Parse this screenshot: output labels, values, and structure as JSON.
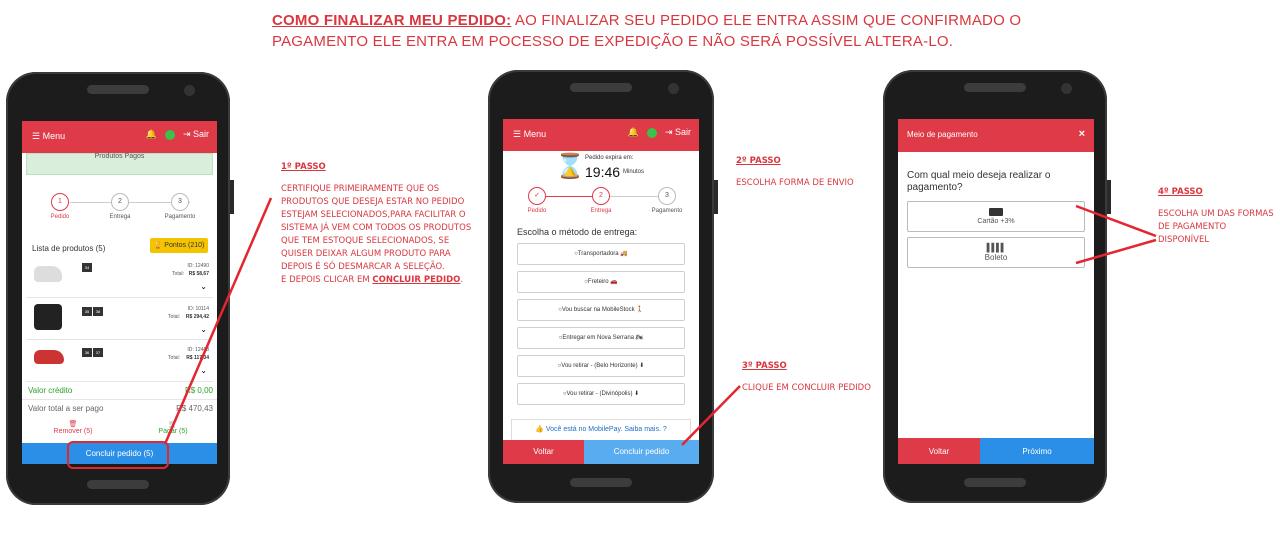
{
  "title": {
    "lead": "COMO FINALIZAR MEU PEDIDO:",
    "rest": " AO FINALIZAR SEU PEDIDO ELE ENTRA ASSIM QUE CONFIRMADO O PAGAMENTO ELE ENTRA EM POCESSO DE EXPEDIÇÃO E NÃO SERÁ POSSÍVEL ALTERA-LO."
  },
  "notes": {
    "step1_title": "1º PASSO",
    "step1_body": "CERTIFIQUE PRIMEIRAMENTE QUE OS PRODUTOS QUE DESEJA ESTAR NO PEDIDO ESTEJAM SELECIONADOS,PARA FACILITAR O SISTEMA JÁ VEM COM TODOS OS PRODUTOS QUE TEM ESTOQUE SELECIONADOS, SE QUISER DEIXAR ALGUM PRODUTO PARA DEPOIS É SÓ DESMARCAR A SELEÇÃO.",
    "step1_tail": "E DEPOIS CLICAR EM ",
    "step1_link": "CONCLUIR PEDIDO",
    "step2_title": "2º PASSO",
    "step2_body": "ESCOLHA FORMA DE ENVIO",
    "step3_title": "3º PASSO",
    "step3_body": "CLIQUE EM CONCLUIR PEDIDO",
    "step4_title": "4º PASSO",
    "step4_body": "ESCOLHA UM DAS FORMAS DE PAGAMENTO DISPONÍVEL"
  },
  "appbar": {
    "menu": "Menu",
    "logout": "Sair"
  },
  "steps": [
    "Pedido",
    "Entrega",
    "Pagamento"
  ],
  "phone1": {
    "banner": "Produtos Pagos",
    "list_title": "Lista de produtos (5)",
    "points": "Pontos (210)",
    "products": [
      {
        "sizes": [
          "34"
        ],
        "id": "ID: 12490",
        "total_label": "Total:",
        "total": "R$ 58,67"
      },
      {
        "sizes": [
          "35",
          "38"
        ],
        "id": "ID: 10114",
        "total_label": "Total:",
        "total": "R$ 294,42"
      },
      {
        "sizes": [
          "36",
          "37"
        ],
        "id": "ID: 12488",
        "total_label": "Total:",
        "total": "R$ 117,34"
      }
    ],
    "credit_label": "Valor crédito",
    "credit_value": "R$ 0,00",
    "total_label": "Valor total a ser pago",
    "total_value": "R$ 470,43",
    "remove": "Remover (5)",
    "pay": "Pagar (5)",
    "conclude": "Concluir pedido (5)"
  },
  "phone2": {
    "expires_label": "Pedido expira em:",
    "timer": "19:46",
    "timer_unit": "Minutos",
    "heading": "Escolha o método de entrega:",
    "options": [
      "Transportadora 🚚",
      "Freteiro 🚗",
      "Vou buscar na MobileStock 🚶",
      "Entregar em Nova Serrana 🏍",
      "Vou retirar - (Belo Horizonte) ⬇",
      "Vou retirar - (Divinópolis) ⬇"
    ],
    "mobilepay": "Você está no MobilePay. Saiba mais.",
    "back": "Voltar",
    "conclude": "Concluir pedido"
  },
  "phone3": {
    "header": "Meio de pagamento",
    "question": "Com qual meio deseja realizar o pagamento?",
    "card": "Cartão +3%",
    "boleto": "Boleto",
    "back": "Voltar",
    "next": "Próximo"
  },
  "colors": {
    "brand_red": "#de3a48",
    "blue": "#2b8fe8",
    "green": "#2ca02c"
  }
}
